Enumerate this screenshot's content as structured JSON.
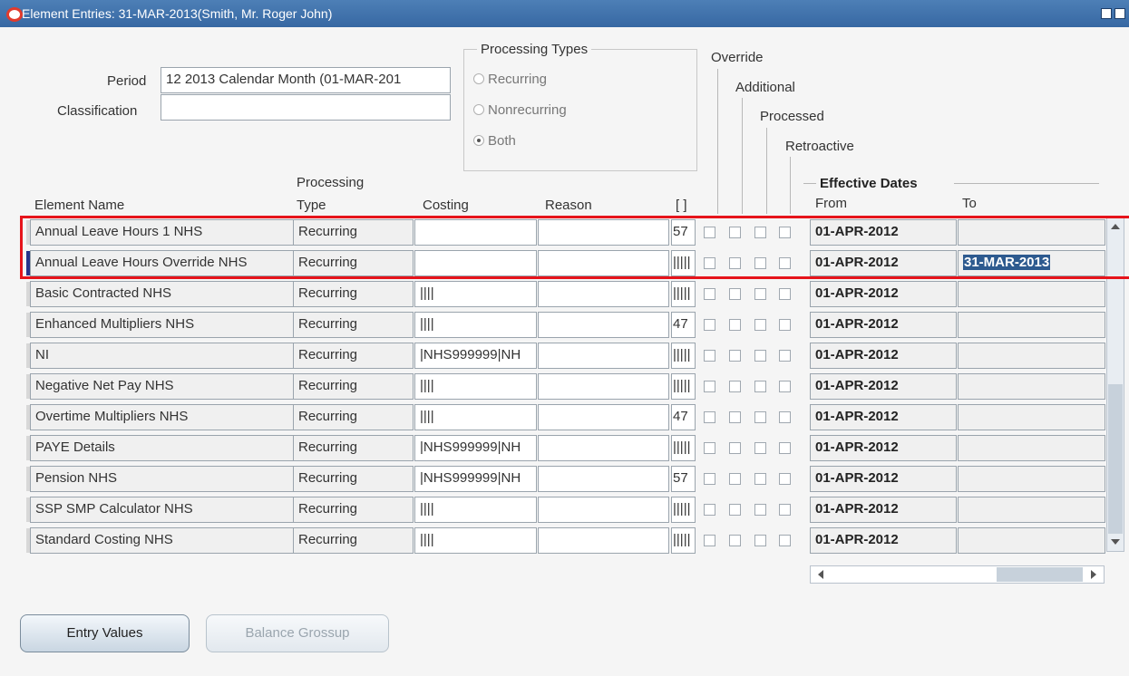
{
  "window": {
    "title": "Element Entries: 31-MAR-2013(Smith, Mr. Roger John)"
  },
  "header": {
    "period_label": "Period",
    "period_value": "12 2013 Calendar Month (01-MAR-201",
    "classification_label": "Classification",
    "classification_value": ""
  },
  "processing_types": {
    "title": "Processing Types",
    "options": [
      "Recurring",
      "Nonrecurring",
      "Both"
    ],
    "selected": "Both"
  },
  "flags": {
    "override": "Override",
    "additional": "Additional",
    "processed": "Processed",
    "retroactive": "Retroactive"
  },
  "columns": {
    "element_name": "Element Name",
    "processing_line1": "Processing",
    "processing_line2": "Type",
    "costing": "Costing",
    "reason": "Reason",
    "bracket": "[ ]",
    "effective_dates": "Effective Dates",
    "from": "From",
    "to": "To"
  },
  "rows": [
    {
      "name": "Annual Leave Hours 1 NHS",
      "type": "Recurring",
      "costing": "",
      "reason": "",
      "dff": "57",
      "from": "01-APR-2012",
      "to": ""
    },
    {
      "name": "Annual Leave Hours Override NHS",
      "type": "Recurring",
      "costing": "",
      "reason": "",
      "dff": "|||||",
      "from": "01-APR-2012",
      "to": "31-MAR-2013"
    },
    {
      "name": "Basic Contracted NHS",
      "type": "Recurring",
      "costing": "||||",
      "reason": "",
      "dff": "|||||",
      "from": "01-APR-2012",
      "to": ""
    },
    {
      "name": "Enhanced Multipliers NHS",
      "type": "Recurring",
      "costing": "||||",
      "reason": "",
      "dff": "47",
      "from": "01-APR-2012",
      "to": ""
    },
    {
      "name": "NI",
      "type": "Recurring",
      "costing": "|NHS999999|NH",
      "reason": "",
      "dff": "|||||",
      "from": "01-APR-2012",
      "to": ""
    },
    {
      "name": "Negative Net Pay NHS",
      "type": "Recurring",
      "costing": "||||",
      "reason": "",
      "dff": "|||||",
      "from": "01-APR-2012",
      "to": ""
    },
    {
      "name": "Overtime Multipliers NHS",
      "type": "Recurring",
      "costing": "||||",
      "reason": "",
      "dff": "47",
      "from": "01-APR-2012",
      "to": ""
    },
    {
      "name": "PAYE Details",
      "type": "Recurring",
      "costing": "|NHS999999|NH",
      "reason": "",
      "dff": "|||||",
      "from": "01-APR-2012",
      "to": ""
    },
    {
      "name": "Pension NHS",
      "type": "Recurring",
      "costing": "|NHS999999|NH",
      "reason": "",
      "dff": "57",
      "from": "01-APR-2012",
      "to": ""
    },
    {
      "name": "SSP SMP Calculator NHS",
      "type": "Recurring",
      "costing": "||||",
      "reason": "",
      "dff": "|||||",
      "from": "01-APR-2012",
      "to": ""
    },
    {
      "name": "Standard Costing NHS",
      "type": "Recurring",
      "costing": "||||",
      "reason": "",
      "dff": "|||||",
      "from": "01-APR-2012",
      "to": ""
    }
  ],
  "buttons": {
    "entry_values": "Entry Values",
    "balance_grossup": "Balance Grossup"
  },
  "colors": {
    "titlebar": "#3768a3",
    "highlight_box": "#e6141b",
    "current_row_marker": "#27348b"
  }
}
